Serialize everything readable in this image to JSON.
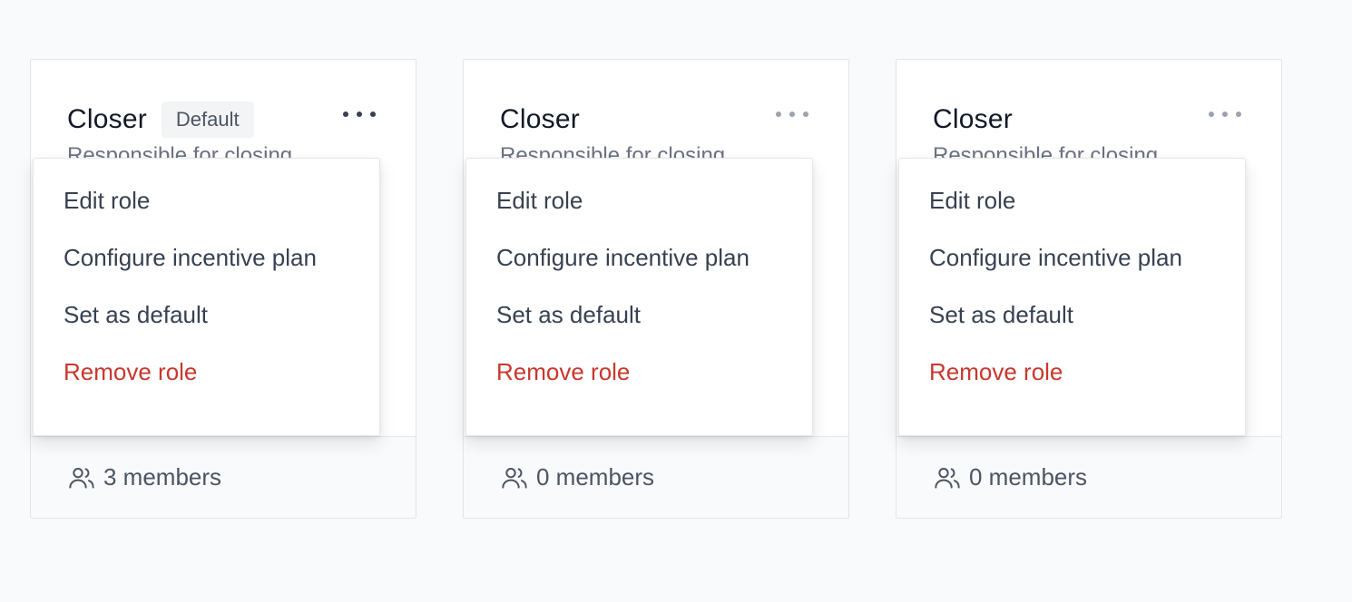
{
  "roles": [
    {
      "title": "Closer",
      "badge": "Default",
      "description": "Responsible for closing",
      "members": "3 members",
      "menu": {
        "edit": "Edit role",
        "configure": "Configure incentive plan",
        "set_default": "Set as default",
        "remove": "Remove role"
      }
    },
    {
      "title": "Closer",
      "description": "Responsible for closing",
      "members": "0 members",
      "menu": {
        "edit": "Edit role",
        "configure": "Configure incentive plan",
        "set_default": "Set as default",
        "remove": "Remove role"
      }
    },
    {
      "title": "Closer",
      "description": "Responsible for closing",
      "members": "0 members",
      "menu": {
        "edit": "Edit role",
        "configure": "Configure incentive plan",
        "set_default": "Set as default",
        "remove": "Remove role"
      }
    }
  ],
  "icons": {
    "more": "more-horizontal-icon",
    "members": "users-icon"
  },
  "colors": {
    "danger": "#c8372d",
    "badge_bg": "#f3f4f6",
    "text": "#111827",
    "muted": "#4b5563"
  }
}
